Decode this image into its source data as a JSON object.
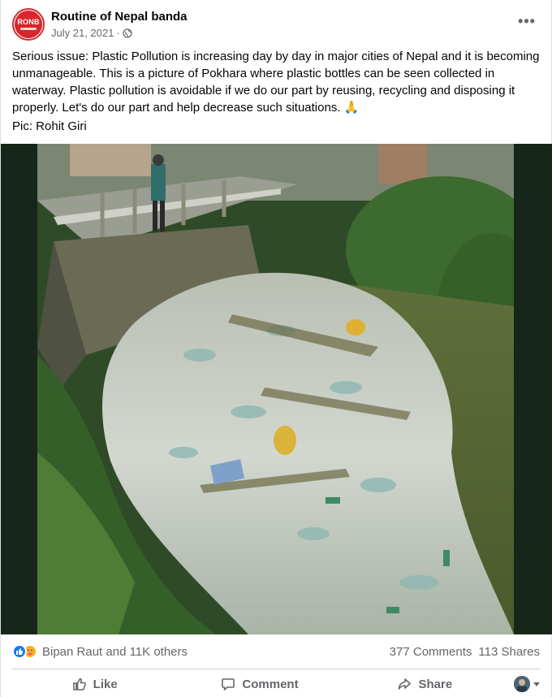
{
  "post": {
    "page_name": "Routine of Nepal banda",
    "avatar_text": "RONB",
    "date": "July 21, 2021",
    "separator": "·",
    "privacy_icon": "globe-icon",
    "more_icon": "more-options-icon",
    "more_label": "•••",
    "text": "Serious issue: Plastic Pollution is increasing day by day in major cities of Nepal and it is becoming unmanageable. This is a picture of Pokhara where plastic bottles can be seen collected in waterway. Plastic pollution is avoidable if we do our part by reusing, recycling and disposing it properly. Let's do our part and help decrease such situations. 🙏",
    "credit": "Pic: Rohit Giri"
  },
  "stats": {
    "reaction_icons": [
      "like-icon",
      "care-icon"
    ],
    "reactors": "Bipan Raut and 11K others",
    "comments": "377 Comments",
    "shares": "113 Shares"
  },
  "actions": {
    "like": "Like",
    "comment": "Comment",
    "share": "Share"
  },
  "colors": {
    "brand_red": "#d7262c",
    "like_blue": "#1877f2",
    "text_secondary": "#65676b"
  }
}
